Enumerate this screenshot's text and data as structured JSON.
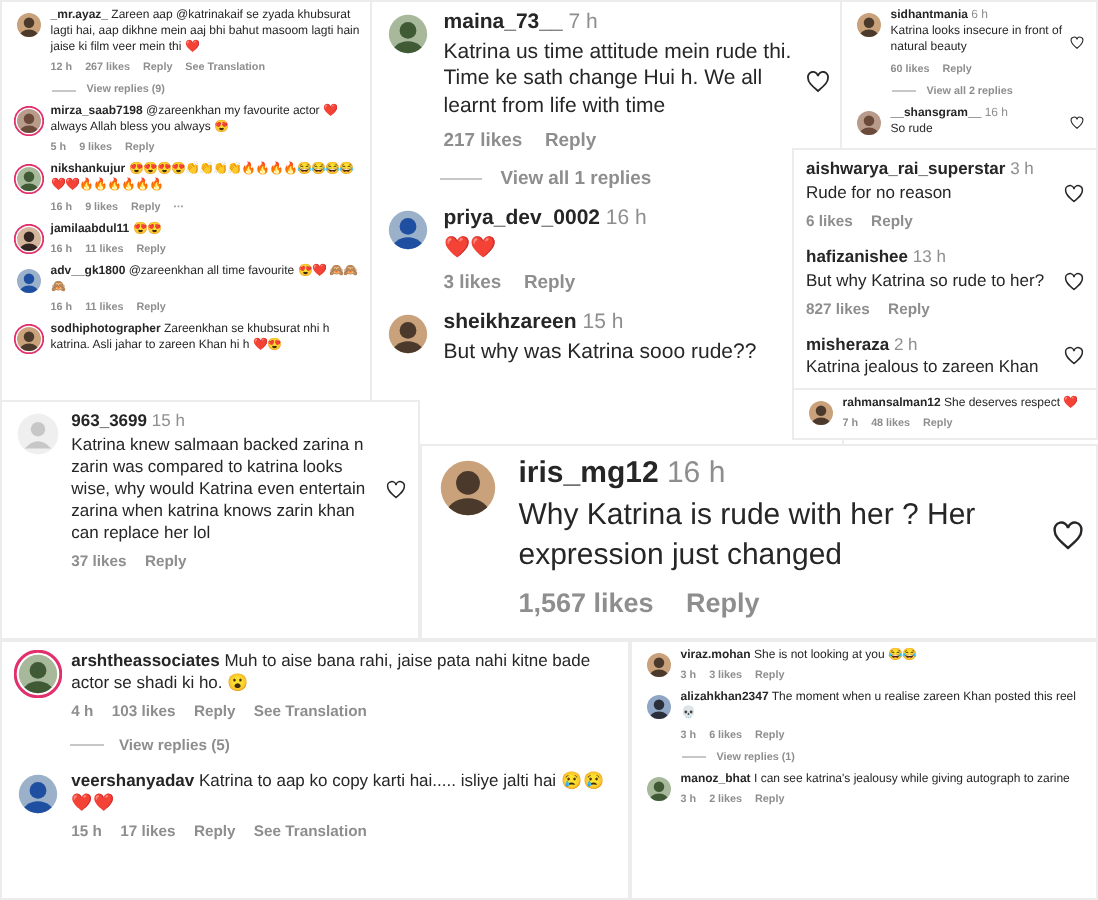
{
  "panels": [
    {
      "items": [
        {
          "kind": "comment",
          "user": "_mr.ayaz_",
          "text": "Zareen aap @katrinakaif se zyada khubsurat lagti hai, aap dikhne mein aaj bhi bahut masoom lagti hain jaise ki film veer mein thi ❤️",
          "meta": [
            "12 h",
            "267 likes",
            "Reply",
            "See Translation"
          ],
          "default_avatar": false,
          "ring": false
        },
        {
          "kind": "view_replies",
          "text": "View replies (9)"
        },
        {
          "kind": "comment",
          "user": "mirza_saab7198",
          "text": "@zareenkhan my favourite actor ❤️ always Allah bless you always 😍",
          "meta": [
            "5 h",
            "9 likes",
            "Reply"
          ],
          "default_avatar": false,
          "ring": true
        },
        {
          "kind": "comment",
          "user": "nikshankujur",
          "text": "😍😍😍😍👏👏👏👏🔥🔥🔥🔥😂😂😂😂❤️❤️🔥🔥🔥🔥🔥🔥",
          "meta": [
            "16 h",
            "9 likes",
            "Reply",
            "···"
          ],
          "default_avatar": false,
          "ring": true
        },
        {
          "kind": "comment",
          "user": "jamilaabdul11",
          "text": "😍😍",
          "meta": [
            "16 h",
            "11 likes",
            "Reply"
          ],
          "default_avatar": false,
          "ring": true
        },
        {
          "kind": "comment",
          "user": "adv__gk1800",
          "text": "@zareenkhan all time favourite 😍❤️ 🙈🙈🙈",
          "meta": [
            "16 h",
            "11 likes",
            "Reply"
          ],
          "default_avatar": false,
          "ring": false
        },
        {
          "kind": "comment",
          "user": "sodhiphotographer",
          "text": "Zareenkhan se khubsurat nhi h katrina. Asli jahar to zareen Khan hi h ❤️😍",
          "default_avatar": false,
          "ring": true
        }
      ]
    },
    {
      "items": [
        {
          "kind": "comment",
          "user": "maina_73__",
          "time": "7 h",
          "text": "Katrina us time attitude mein rude thi. Time ke sath change Hui h. We all learnt from life with time",
          "meta": [
            "217 likes",
            "Reply"
          ],
          "default_avatar": false,
          "ring": false,
          "like_button": true
        },
        {
          "kind": "view_replies",
          "text": "View all 1 replies"
        },
        {
          "kind": "comment",
          "user": "priya_dev_0002",
          "time": "16 h",
          "text": "❤️❤️",
          "meta": [
            "3 likes",
            "Reply"
          ],
          "default_avatar": false,
          "ring": false
        },
        {
          "kind": "comment",
          "user": "sheikhzareen",
          "time": "15 h",
          "text": "But why was Katrina sooo rude??",
          "default_avatar": false,
          "ring": false
        }
      ]
    },
    {
      "items": [
        {
          "kind": "comment",
          "user": "sidhantmania",
          "time": "6 h",
          "text": "Katrina looks insecure in front of natural beauty",
          "meta": [
            "60 likes",
            "Reply"
          ],
          "default_avatar": false,
          "ring": false,
          "like_button": true
        },
        {
          "kind": "view_replies",
          "text": "View all 2 replies"
        },
        {
          "kind": "comment",
          "user": "__shansgram__",
          "time": "16 h",
          "text": "So rude",
          "default_avatar": false,
          "ring": false,
          "like_button": true
        }
      ]
    },
    {
      "items": [
        {
          "kind": "comment",
          "user": "aishwarya_rai_superstar",
          "time": "3 h",
          "text": "Rude for no reason",
          "meta": [
            "6 likes",
            "Reply"
          ],
          "like_button": true
        },
        {
          "kind": "comment",
          "user": "hafizanishee",
          "time": "13 h",
          "text": "But why Katrina so rude to her?",
          "meta": [
            "827 likes",
            "Reply"
          ],
          "like_button": true
        },
        {
          "kind": "comment",
          "user": "misheraza",
          "time": "2 h",
          "text": "Katrina jealous to zareen Khan",
          "like_button": true
        }
      ]
    },
    {
      "items": [
        {
          "kind": "comment",
          "user": "rahmansalman12",
          "text": "She deserves respect ❤️",
          "meta": [
            "7 h",
            "48 likes",
            "Reply"
          ],
          "default_avatar": false,
          "ring": false
        }
      ]
    },
    {
      "items": [
        {
          "kind": "comment",
          "user": "963_3699",
          "time": "15 h",
          "text": "Katrina knew salmaan backed zarina n zarin was compared to katrina looks wise, why would Katrina even entertain zarina when katrina knows zarin khan can replace her lol",
          "meta": [
            "37 likes",
            "Reply"
          ],
          "default_avatar": true,
          "ring": false,
          "like_button": true
        }
      ]
    },
    {
      "items": [
        {
          "kind": "comment",
          "user": "iris_mg12",
          "time": "16 h",
          "text": "Why Katrina is rude with her ? Her expression just changed",
          "meta": [
            "1,567 likes",
            "Reply"
          ],
          "default_avatar": false,
          "ring": false,
          "like_button": true
        }
      ]
    },
    {
      "items": [
        {
          "kind": "comment",
          "user": "arshtheassociates",
          "text": "Muh to aise bana rahi, jaise pata nahi kitne bade actor se shadi ki ho. 😮",
          "meta": [
            "4 h",
            "103 likes",
            "Reply",
            "See Translation"
          ],
          "default_avatar": false,
          "ring": true
        },
        {
          "kind": "view_replies",
          "text": "View replies (5)"
        },
        {
          "kind": "comment",
          "user": "veershanyadav",
          "text": "Katrina to aap ko copy karti hai..... isliye jalti hai 😢😢❤️❤️",
          "meta": [
            "15 h",
            "17 likes",
            "Reply",
            "See Translation"
          ],
          "default_avatar": false,
          "ring": false
        }
      ]
    },
    {
      "items": [
        {
          "kind": "comment",
          "user": "viraz.mohan",
          "text": "She is not looking at you 😂😂",
          "meta": [
            "3 h",
            "3 likes",
            "Reply"
          ],
          "default_avatar": false,
          "ring": false
        },
        {
          "kind": "comment",
          "user": "alizahkhan2347",
          "text": "The moment when u realise zareen Khan posted this reel💀",
          "meta": [
            "3 h",
            "6 likes",
            "Reply"
          ],
          "default_avatar": false,
          "ring": false
        },
        {
          "kind": "view_replies",
          "text": "View replies (1)"
        },
        {
          "kind": "comment",
          "user": "manoz_bhat",
          "text": "I can see katrina's jealousy while giving autograph to zarine",
          "meta": [
            "3 h",
            "2 likes",
            "Reply"
          ],
          "default_avatar": false,
          "ring": false
        }
      ]
    }
  ]
}
